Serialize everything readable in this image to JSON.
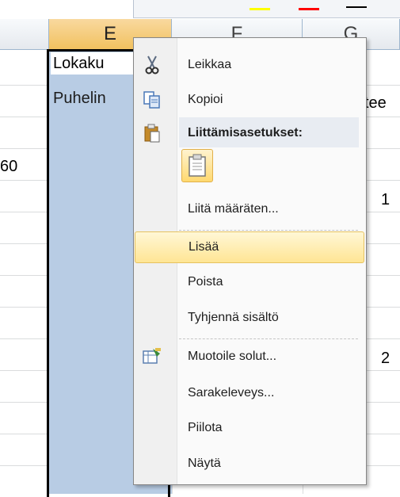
{
  "columns": [
    {
      "letter": "E",
      "selected": true
    },
    {
      "letter": "F",
      "selected": false
    },
    {
      "letter": "G",
      "selected": false
    }
  ],
  "cells": {
    "row1_e": "Lokaku",
    "row2_e": "Puhelin",
    "row2_g": "tee",
    "row4_d": "60",
    "row5_g": "1",
    "row11_g": "2"
  },
  "context_menu": {
    "items": [
      {
        "id": "cut",
        "label": "Leikkaa",
        "icon": "scissors-icon"
      },
      {
        "id": "copy",
        "label": "Kopioi",
        "icon": "copy-icon"
      },
      {
        "id": "paste_options",
        "label": "Liittämisasetukset:",
        "icon": "paste-icon"
      },
      {
        "id": "paste_special",
        "label": "Liitä määräten..."
      },
      {
        "id": "insert",
        "label": "Lisää",
        "highlighted": true
      },
      {
        "id": "delete",
        "label": "Poista"
      },
      {
        "id": "clear",
        "label": "Tyhjennä sisältö"
      },
      {
        "id": "format_cells",
        "label": "Muotoile solut...",
        "icon": "format-cells-icon"
      },
      {
        "id": "column_width",
        "label": "Sarakeleveys..."
      },
      {
        "id": "hide",
        "label": "Piilota"
      },
      {
        "id": "unhide",
        "label": "Näytä"
      }
    ],
    "paste_option_icon": "paste-clipboard-icon"
  },
  "colors": {
    "selection": "#b8cce4",
    "header_selected": "#f1c15f",
    "menu_highlight": "#ffe594"
  }
}
